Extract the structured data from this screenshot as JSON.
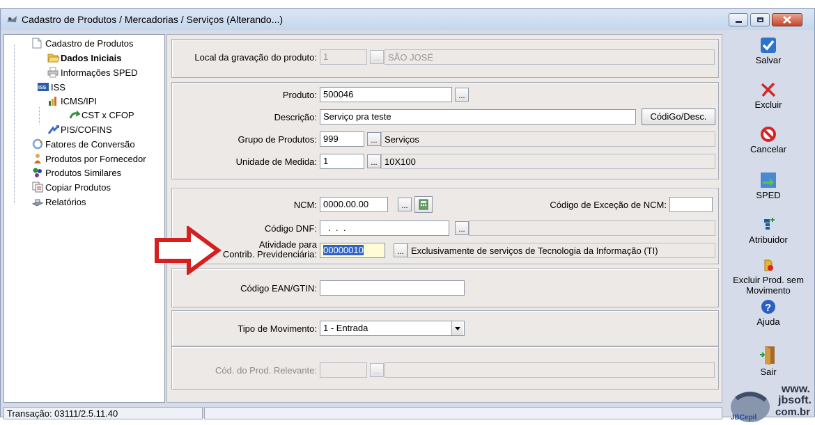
{
  "window": {
    "title": "Cadastro de Produtos / Mercadorias / Serviços (Alterando...)",
    "minimize_icon": "minimize-icon",
    "maximize_icon": "maximize-icon",
    "close_icon": "close-icon"
  },
  "tree": {
    "items": [
      {
        "label": "Cadastro de Produtos",
        "icon": "document-icon"
      },
      {
        "label": "Dados Iniciais",
        "icon": "folder-open-icon",
        "bold": true
      },
      {
        "label": "Informações SPED",
        "icon": "printer-icon"
      },
      {
        "label": "ISS",
        "icon": "iss-icon"
      },
      {
        "label": "ICMS/IPI",
        "icon": "icms-icon"
      },
      {
        "label": "CST x CFOP",
        "icon": "cst-arrow-icon"
      },
      {
        "label": "PIS/COFINS",
        "icon": "pis-icon"
      },
      {
        "label": "Fatores de Conversão",
        "icon": "conversion-icon"
      },
      {
        "label": "Produtos por Fornecedor",
        "icon": "supplier-icon"
      },
      {
        "label": "Produtos Similares",
        "icon": "similar-icon"
      },
      {
        "label": "Copiar Produtos",
        "icon": "copy-icon"
      },
      {
        "label": "Relatórios",
        "icon": "reports-icon"
      }
    ]
  },
  "form": {
    "local": {
      "label": "Local da gravação do produto:",
      "value": "1",
      "desc": "SÃO JOSÉ"
    },
    "produto": {
      "label": "Produto:",
      "value": "500046"
    },
    "descricao": {
      "label": "Descrição:",
      "value": "Serviço pra teste",
      "button": "CódiGo/Desc."
    },
    "grupo": {
      "label": "Grupo de Produtos:",
      "value": "999",
      "desc": "Serviços"
    },
    "unidade": {
      "label": "Unidade de Medida:",
      "value": "1",
      "desc": "10X100"
    },
    "ncm": {
      "label": "NCM:",
      "value": "0000.00.00",
      "excecao_label": "Código de Exceção de NCM:",
      "excecao_value": ""
    },
    "dnf": {
      "label": "Código DNF:",
      "value": "  .  .  ."
    },
    "atividade": {
      "label_line1": "Atividade para",
      "label_line2": "Contrib. Previdenciária:",
      "value": "00000010",
      "desc": "Exclusivamente de serviços de Tecnologia da Informação (TI)"
    },
    "ean": {
      "label": "Código EAN/GTIN:",
      "value": ""
    },
    "movimento": {
      "label": "Tipo de Movimento:",
      "value": "1 - Entrada"
    },
    "relevante": {
      "label": "Cód. do Prod. Relevante:",
      "value": ""
    },
    "dots_label": "..."
  },
  "toolbar": {
    "items": [
      {
        "label": "Salvar",
        "icon": "checkmark-icon"
      },
      {
        "label": "Excluir",
        "icon": "red-x-icon"
      },
      {
        "label": "Cancelar",
        "icon": "cancel-icon"
      },
      {
        "label": "SPED",
        "icon": "sped-icon"
      },
      {
        "label": "Atribuidor",
        "icon": "atribuidor-icon"
      },
      {
        "label": "Excluir Prod. sem Movimento",
        "icon": "delete-product-icon"
      },
      {
        "label": "Ajuda",
        "icon": "help-icon"
      },
      {
        "label": "Sair",
        "icon": "exit-door-icon"
      }
    ]
  },
  "status": {
    "transacao": "Transação: 03111/2.5.11.40",
    "empty": ""
  },
  "logo": {
    "line1": "www.",
    "line2": "jbsoft.",
    "line3": "com.br",
    "brand": "JBCepil"
  }
}
